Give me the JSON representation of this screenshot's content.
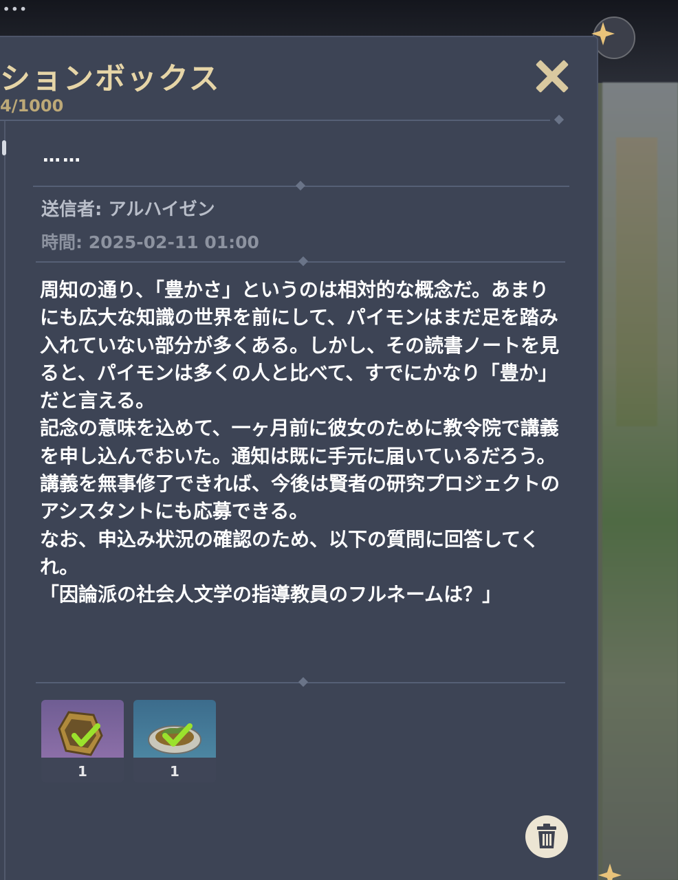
{
  "window": {
    "dots": "•••"
  },
  "panel": {
    "title": "ションボックス",
    "count": "4/1000"
  },
  "mail": {
    "subject": "……",
    "sender_label": "送信者: ",
    "sender": "アルハイゼン",
    "time_label": "時間: ",
    "time": "2025-02-11 01:00",
    "body": [
      "周知の通り、「豊かさ」というのは相対的な概念だ。あまりにも広大な知識の世界を前にして、パイモンはまだ足を踏み入れていない部分が多くある。しかし、その読書ノートを見ると、パイモンは多くの人と比べて、すでにかなり「豊か」だと言える。",
      "記念の意味を込めて、一ヶ月前に彼女のために教令院で講義を申し込んでおいた。通知は既に手元に届いているだろう。",
      "講義を無事修了できれば、今後は賢者の研究プロジェクトのアシスタントにも応募できる。",
      "なお、申込み状況の確認のため、以下の質問に回答してくれ。",
      "「因論派の社会人文学の指導教員のフルネームは？」"
    ]
  },
  "attachments": [
    {
      "icon": "gold-sigil-item-icon",
      "qty": "1",
      "claimed": true,
      "rarity_color": "#8c6fa8"
    },
    {
      "icon": "food-dish-item-icon",
      "qty": "1",
      "claimed": true,
      "rarity_color": "#4c86a2"
    }
  ],
  "colors": {
    "panel_bg": "#3d4455",
    "title": "#e6d5a7",
    "check": "#9be22d"
  }
}
